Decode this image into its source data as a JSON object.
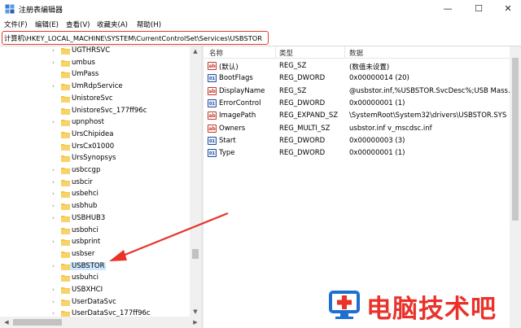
{
  "window": {
    "title": "注册表编辑器",
    "minimize_glyph": "—",
    "maximize_glyph": "☐",
    "close_glyph": "✕"
  },
  "menu": [
    "文件(F)",
    "编辑(E)",
    "查看(V)",
    "收藏夹(A)",
    "帮助(H)"
  ],
  "address": "计算机\\HKEY_LOCAL_MACHINE\\SYSTEM\\CurrentControlSet\\Services\\USBSTOR",
  "tree": {
    "items": [
      {
        "label": "UGTHRSVC",
        "expandable": true
      },
      {
        "label": "umbus",
        "expandable": true
      },
      {
        "label": "UmPass",
        "expandable": false
      },
      {
        "label": "UmRdpService",
        "expandable": true
      },
      {
        "label": "UnistoreSvc",
        "expandable": false
      },
      {
        "label": "UnistoreSvc_177ff96c",
        "expandable": false
      },
      {
        "label": "upnphost",
        "expandable": true
      },
      {
        "label": "UrsChipidea",
        "expandable": false
      },
      {
        "label": "UrsCx01000",
        "expandable": false
      },
      {
        "label": "UrsSynopsys",
        "expandable": false
      },
      {
        "label": "usbccgp",
        "expandable": true
      },
      {
        "label": "usbcir",
        "expandable": true
      },
      {
        "label": "usbehci",
        "expandable": true
      },
      {
        "label": "usbhub",
        "expandable": true
      },
      {
        "label": "USBHUB3",
        "expandable": true
      },
      {
        "label": "usbohci",
        "expandable": false
      },
      {
        "label": "usbprint",
        "expandable": true
      },
      {
        "label": "usbser",
        "expandable": false
      },
      {
        "label": "USBSTOR",
        "expandable": true,
        "selected": true
      },
      {
        "label": "usbuhci",
        "expandable": false
      },
      {
        "label": "USBXHCI",
        "expandable": true
      },
      {
        "label": "UserDataSvc",
        "expandable": true
      },
      {
        "label": "UserDataSvc_177ff96c",
        "expandable": true
      }
    ]
  },
  "values_table": {
    "headers": [
      "名称",
      "类型",
      "数据"
    ],
    "rows": [
      {
        "icon": "ab",
        "name": "(默认)",
        "type": "REG_SZ",
        "data": "(数值未设置)"
      },
      {
        "icon": "bin",
        "name": "BootFlags",
        "type": "REG_DWORD",
        "data": "0x00000014 (20)"
      },
      {
        "icon": "ab",
        "name": "DisplayName",
        "type": "REG_SZ",
        "data": "@usbstor.inf,%USBSTOR.SvcDesc%;USB Mass..."
      },
      {
        "icon": "bin",
        "name": "ErrorControl",
        "type": "REG_DWORD",
        "data": "0x00000001 (1)"
      },
      {
        "icon": "ab",
        "name": "ImagePath",
        "type": "REG_EXPAND_SZ",
        "data": "\\SystemRoot\\System32\\drivers\\USBSTOR.SYS"
      },
      {
        "icon": "ab",
        "name": "Owners",
        "type": "REG_MULTI_SZ",
        "data": "usbstor.inf v_mscdsc.inf"
      },
      {
        "icon": "bin",
        "name": "Start",
        "type": "REG_DWORD",
        "data": "0x00000003 (3)"
      },
      {
        "icon": "bin",
        "name": "Type",
        "type": "REG_DWORD",
        "data": "0x00000001 (1)"
      }
    ]
  },
  "watermark": {
    "text": "电脑技术吧"
  },
  "colors": {
    "highlight_border": "#e03a2e",
    "selection": "#cce8ff",
    "folder": "#f5c542",
    "arrow": "#e8322a",
    "watermark_red": "#e8322a",
    "watermark_blue": "#1f6fd1"
  }
}
